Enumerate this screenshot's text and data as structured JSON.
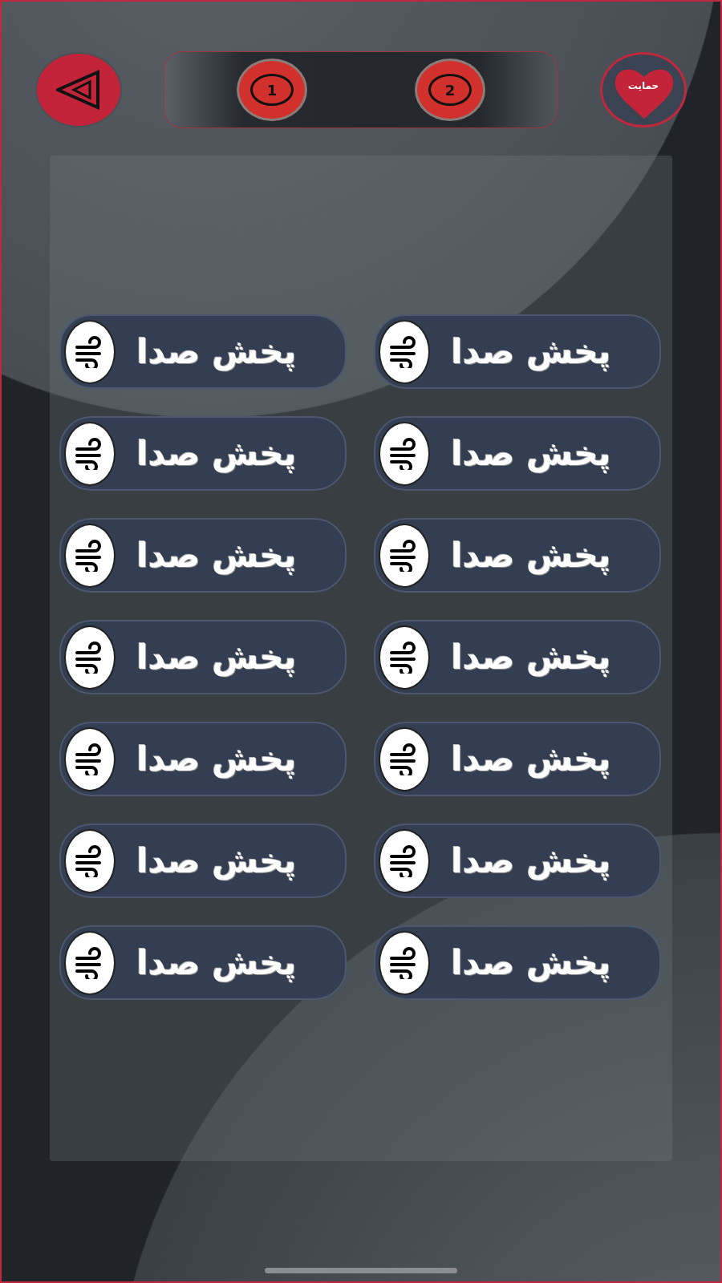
{
  "pages": [
    {
      "label": "2"
    },
    {
      "label": "1"
    }
  ],
  "support_label": "حمایت",
  "sound_buttons": [
    {
      "label": "پخش صدا"
    },
    {
      "label": "پخش صدا"
    },
    {
      "label": "پخش صدا"
    },
    {
      "label": "پخش صدا"
    },
    {
      "label": "پخش صدا"
    },
    {
      "label": "پخش صدا"
    },
    {
      "label": "پخش صدا"
    },
    {
      "label": "پخش صدا"
    },
    {
      "label": "پخش صدا"
    },
    {
      "label": "پخش صدا"
    },
    {
      "label": "پخش صدا"
    },
    {
      "label": "پخش صدا"
    },
    {
      "label": "پخش صدا"
    },
    {
      "label": "پخش صدا"
    }
  ]
}
